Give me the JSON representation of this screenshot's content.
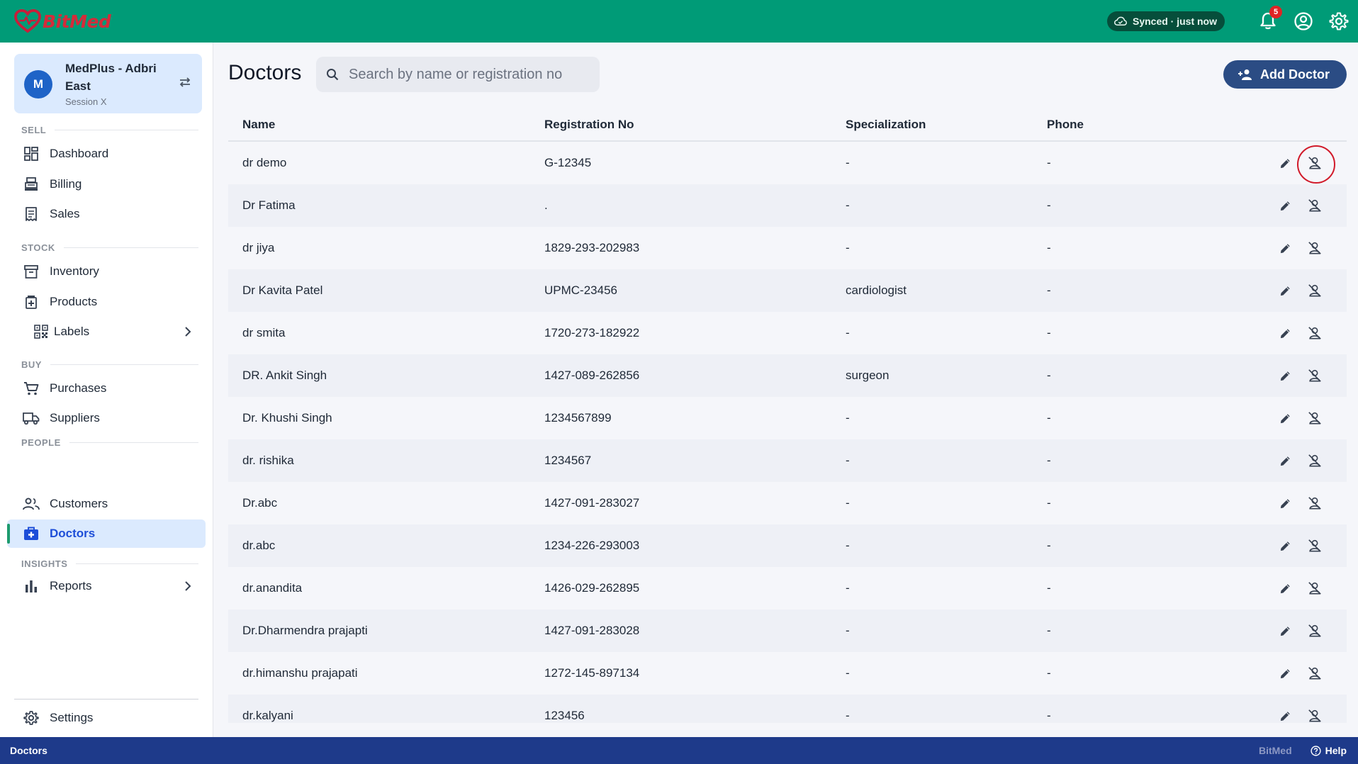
{
  "app": {
    "brand": "BitMed",
    "sync_status": "Synced · just now",
    "notification_count": "5"
  },
  "store": {
    "initial": "M",
    "name": "MedPlus - Adbri East",
    "session": "Session X"
  },
  "sidebar": {
    "sections": [
      {
        "label": "SELL",
        "items": [
          {
            "label": "Dashboard",
            "icon": "dashboard-icon"
          },
          {
            "label": "Billing",
            "icon": "billing-icon"
          },
          {
            "label": "Sales",
            "icon": "sales-icon"
          }
        ]
      },
      {
        "label": "STOCK",
        "items": [
          {
            "label": "Inventory",
            "icon": "inventory-icon"
          },
          {
            "label": "Products",
            "icon": "products-icon"
          },
          {
            "label": "Labels",
            "icon": "qr-code-icon"
          }
        ]
      },
      {
        "label": "BUY",
        "items": [
          {
            "label": "Purchases",
            "icon": "cart-icon"
          },
          {
            "label": "Suppliers",
            "icon": "truck-icon"
          }
        ]
      },
      {
        "label": "PEOPLE",
        "items": [
          {
            "label": "Customers",
            "icon": "people-icon"
          },
          {
            "label": "Doctors",
            "icon": "medical-bag-icon"
          }
        ]
      },
      {
        "label": "INSIGHTS",
        "items": [
          {
            "label": "Reports",
            "icon": "bar-chart-icon"
          }
        ]
      }
    ],
    "settings_label": "Settings",
    "active_item": "Doctors"
  },
  "main": {
    "title": "Doctors",
    "search_placeholder": "Search by name or registration no",
    "add_button": "Add Doctor",
    "columns": [
      "Name",
      "Registration No",
      "Specialization",
      "Phone"
    ],
    "rows": [
      {
        "name": "dr demo",
        "reg": "G-12345",
        "spec": "-",
        "phone": "-"
      },
      {
        "name": "Dr Fatima",
        "reg": ".",
        "spec": "-",
        "phone": "-"
      },
      {
        "name": "dr jiya",
        "reg": "1829-293-202983",
        "spec": "-",
        "phone": "-"
      },
      {
        "name": "Dr Kavita Patel",
        "reg": "UPMC-23456",
        "spec": "cardiologist",
        "phone": "-"
      },
      {
        "name": "dr smita",
        "reg": "1720-273-182922",
        "spec": "-",
        "phone": "-"
      },
      {
        "name": "DR. Ankit Singh",
        "reg": "1427-089-262856",
        "spec": "surgeon",
        "phone": "-"
      },
      {
        "name": "Dr. Khushi Singh",
        "reg": "1234567899",
        "spec": "-",
        "phone": "-"
      },
      {
        "name": "dr. rishika",
        "reg": "1234567",
        "spec": "-",
        "phone": "-"
      },
      {
        "name": "Dr.abc",
        "reg": "1427-091-283027",
        "spec": "-",
        "phone": "-"
      },
      {
        "name": "dr.abc",
        "reg": "1234-226-293003",
        "spec": "-",
        "phone": "-"
      },
      {
        "name": "dr.anandita",
        "reg": "1426-029-262895",
        "spec": "-",
        "phone": "-"
      },
      {
        "name": "Dr.Dharmendra prajapti",
        "reg": "1427-091-283028",
        "spec": "-",
        "phone": "-"
      },
      {
        "name": "dr.himanshu prajapati",
        "reg": "1272-145-897134",
        "spec": "-",
        "phone": "-"
      },
      {
        "name": "dr.kalyani",
        "reg": "123456",
        "spec": "-",
        "phone": "-"
      }
    ]
  },
  "footer": {
    "page": "Doctors",
    "brand": "BitMed",
    "help": "Help"
  },
  "colors": {
    "topbar": "#009b77",
    "accent_blue": "#2b4c84",
    "bottombar": "#1e3a8a",
    "active_nav": "#dbeafe",
    "danger_ring": "#d11a2a"
  }
}
